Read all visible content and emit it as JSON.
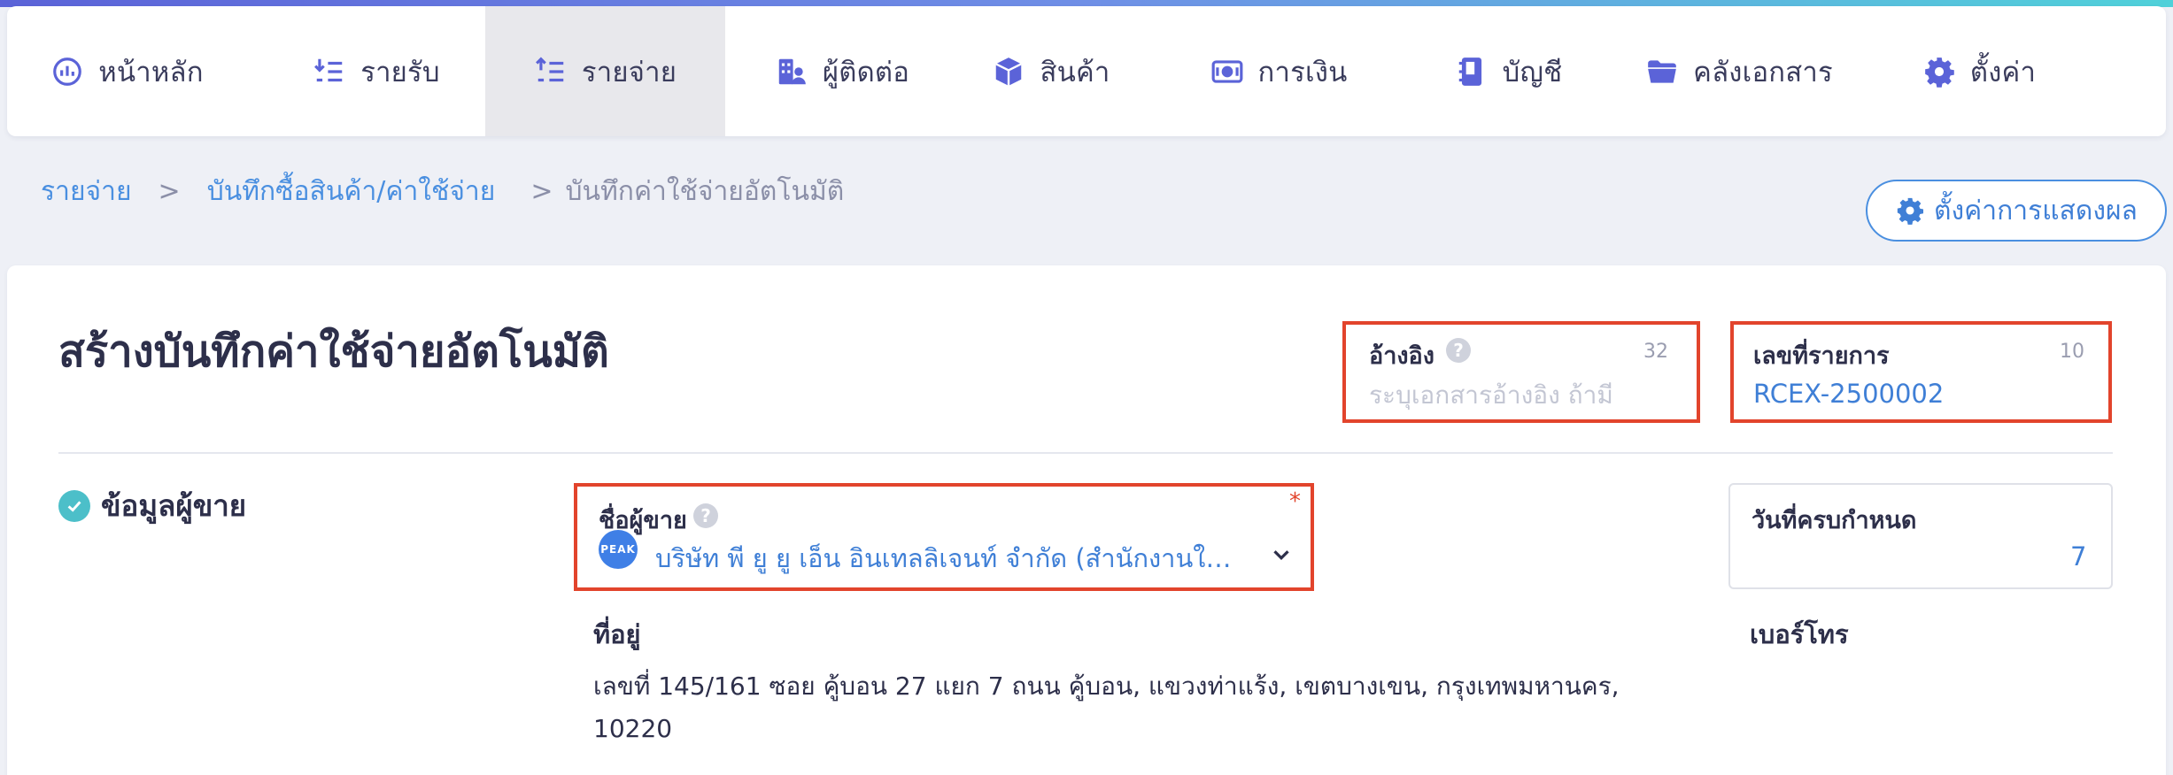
{
  "colors": {
    "accent": "#4a8fe0",
    "highlight": "#e2442c",
    "nav_active_bg": "#e8e8ec",
    "check": "#4cbfc9"
  },
  "nav": {
    "items": [
      {
        "label": "หน้าหลัก",
        "icon": "dashboard-icon"
      },
      {
        "label": "รายรับ",
        "icon": "income-list-icon"
      },
      {
        "label": "รายจ่าย",
        "icon": "expense-list-icon",
        "active": true
      },
      {
        "label": "ผู้ติดต่อ",
        "icon": "contacts-icon"
      },
      {
        "label": "สินค้า",
        "icon": "box-icon"
      },
      {
        "label": "การเงิน",
        "icon": "money-icon"
      },
      {
        "label": "บัญชี",
        "icon": "ledger-icon"
      },
      {
        "label": "คลังเอกสาร",
        "icon": "folder-icon"
      },
      {
        "label": "ตั้งค่า",
        "icon": "gear-icon"
      }
    ]
  },
  "breadcrumb": {
    "items": [
      "รายจ่าย",
      "บันทึกซื้อสินค้า/ค่าใช้จ่าย",
      "บันทึกค่าใช้จ่ายอัตโนมัติ"
    ],
    "separator": ">"
  },
  "display_settings": {
    "label": "ตั้งค่าการแสดงผล"
  },
  "page": {
    "title": "สร้างบันทึกค่าใช้จ่ายอัตโนมัติ"
  },
  "reference": {
    "label": "อ้างอิง",
    "counter": "32",
    "placeholder": "ระบุเอกสารอ้างอิง ถ้ามี",
    "value": ""
  },
  "doc_number": {
    "label": "เลขที่รายการ",
    "counter": "10",
    "value": "RCEX-2500002"
  },
  "vendor_section": {
    "title": "ข้อมูลผู้ขาย"
  },
  "vendor": {
    "label": "ชื่อผู้ขาย",
    "required_mark": "*",
    "logo_text": "PEAK",
    "value": "บริษัท พี ยู ยู เอ็น อินเทลลิเจนท์ จำกัด (สำนักงานให..."
  },
  "due": {
    "label": "วันที่ครบกำหนด",
    "value": "7"
  },
  "address": {
    "label": "ที่อยู่",
    "value": "เลขที่ 145/161 ซอย คู้บอน 27 แยก 7 ถนน คู้บอน, แขวงท่าแร้ง, เขตบางเขน, กรุงเทพมหานคร, 10220"
  },
  "phone": {
    "label": "เบอร์โทร"
  }
}
